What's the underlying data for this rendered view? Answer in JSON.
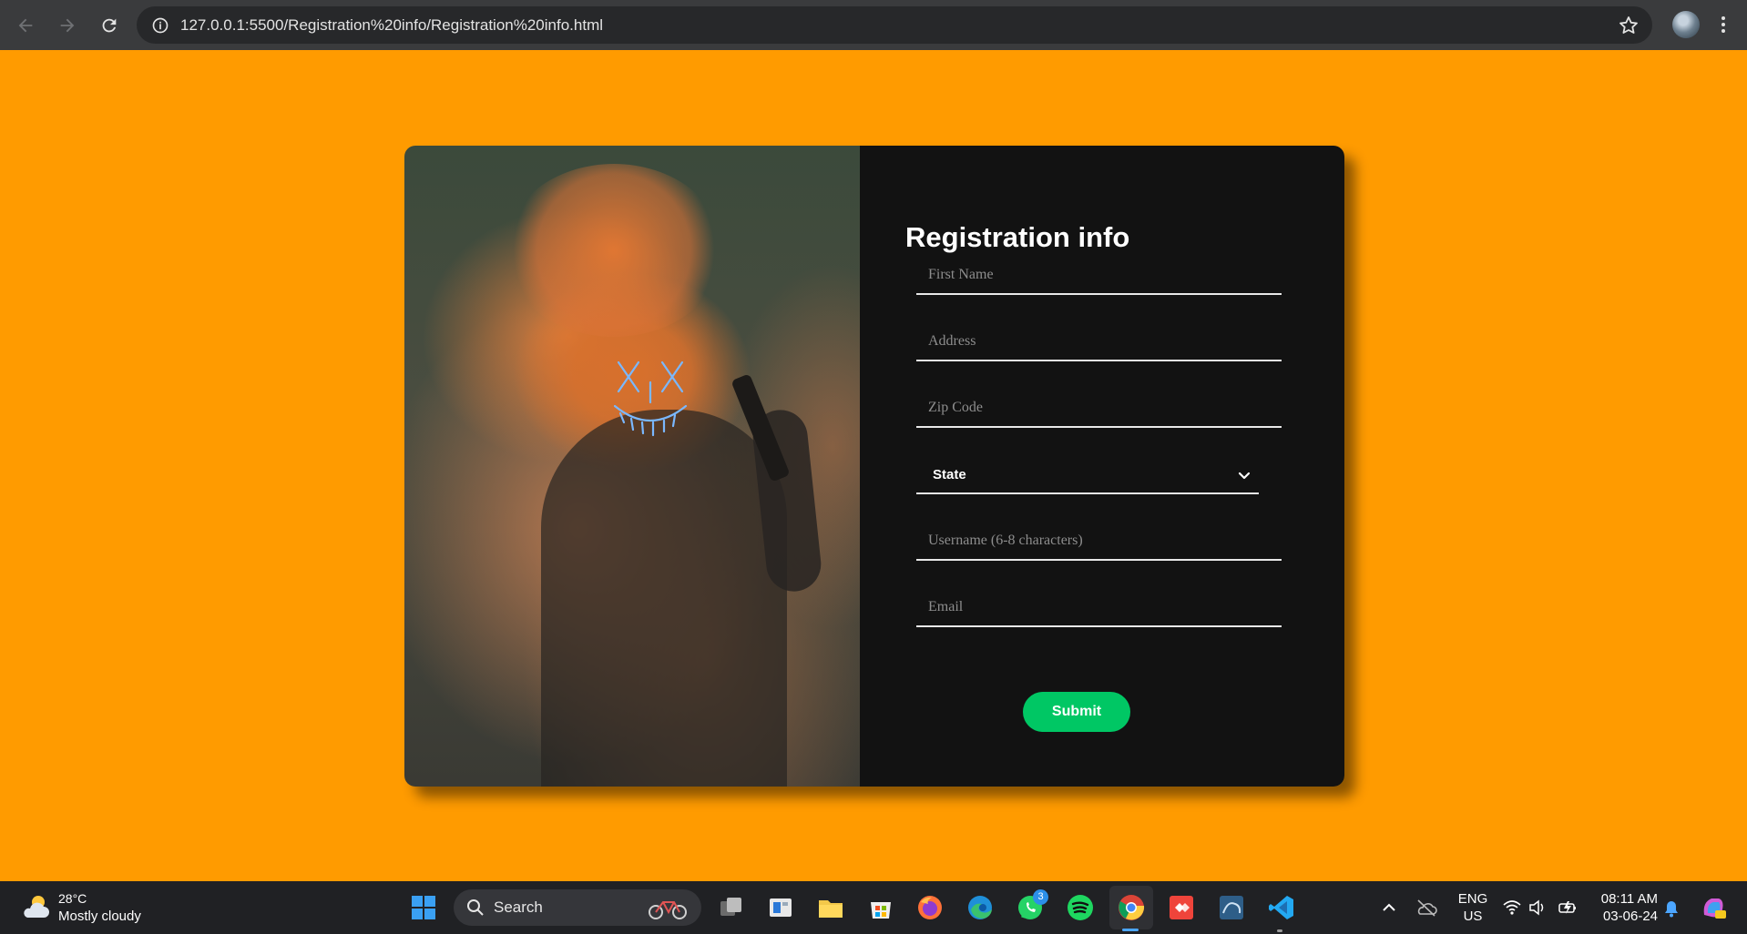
{
  "browser": {
    "url": "127.0.0.1:5500/Registration%20info/Registration%20info.html",
    "icons": [
      "back-arrow-icon",
      "forward-arrow-icon",
      "reload-icon",
      "site-info-icon",
      "bookmark-star-icon",
      "profile-avatar",
      "menu-dots-icon"
    ]
  },
  "page": {
    "background_color": "#ff9b00",
    "form": {
      "title": "Registration info",
      "fields": {
        "first_name_placeholder": "First Name",
        "address_placeholder": "Address",
        "zip_placeholder": "Zip Code",
        "state_selected": "State",
        "username_placeholder": "Username (6-8 characters)",
        "email_placeholder": "Email"
      },
      "submit_label": "Submit",
      "submit_color": "#00c764"
    }
  },
  "taskbar": {
    "weather": {
      "temp": "28°C",
      "condition": "Mostly cloudy"
    },
    "search_label": "Search",
    "whatsapp_badge": "3",
    "lang_line1": "ENG",
    "lang_line2": "US",
    "time": "08:11 AM",
    "date": "03-06-24",
    "apps": [
      "windows-start-icon",
      "task-view-icon",
      "widgets-icon",
      "file-explorer-icon",
      "microsoft-store-icon",
      "firefox-icon",
      "edge-icon",
      "whatsapp-icon",
      "spotify-icon",
      "chrome-icon",
      "anydesk-icon",
      "mysql-workbench-icon",
      "vscode-icon"
    ]
  }
}
